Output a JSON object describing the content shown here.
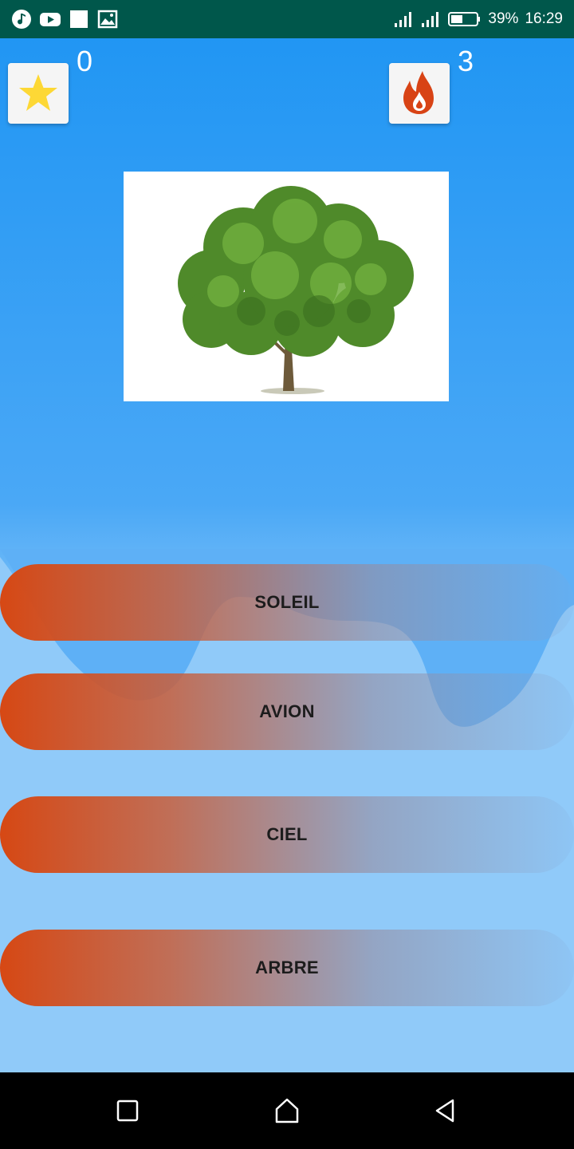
{
  "status_bar": {
    "icons": [
      "music-note-icon",
      "youtube-icon",
      "square-notification-icon",
      "image-icon"
    ],
    "signal_icons": [
      "signal-1-icon",
      "signal-2-icon"
    ],
    "battery_percent": "39%",
    "time": "16:29"
  },
  "game": {
    "score": "0",
    "streak": "3",
    "score_icon": "star-icon",
    "streak_icon": "flame-icon",
    "picture_icon": "tree-icon"
  },
  "answers": [
    {
      "label": "SOLEIL"
    },
    {
      "label": "AVION"
    },
    {
      "label": "CIEL"
    },
    {
      "label": "ARBRE"
    }
  ],
  "nav": {
    "icons": [
      "recents-square-icon",
      "home-icon",
      "back-triangle-icon"
    ]
  },
  "colors": {
    "status_bar": "#00574b",
    "sky_top": "#2196f3",
    "sky_bottom": "#90caf9",
    "answer_start": "#d64814",
    "star": "#fdd835",
    "flame": "#d84315"
  }
}
